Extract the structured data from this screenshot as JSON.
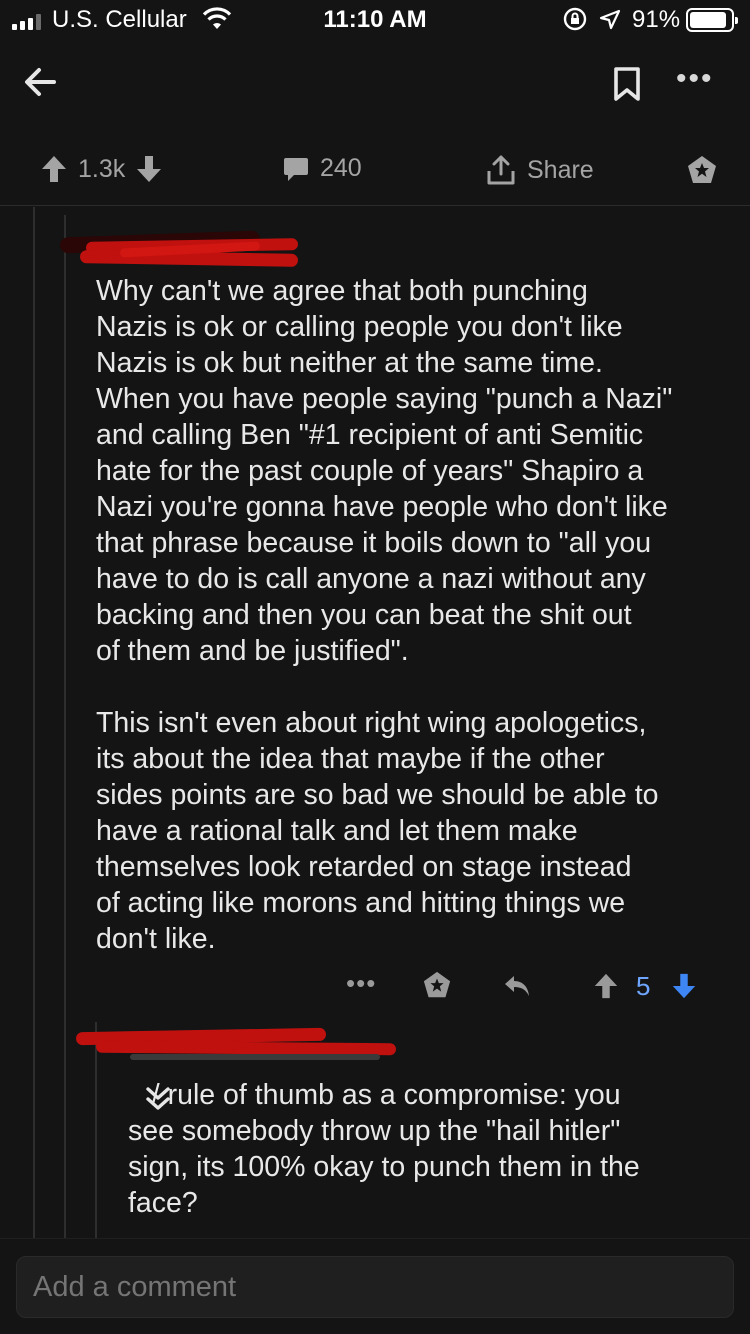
{
  "status_bar": {
    "carrier": "U.S. Cellular",
    "time": "11:10 AM",
    "battery": "91%"
  },
  "post_actions": {
    "upvotes": "1.3k",
    "comments": "240",
    "share_label": "Share"
  },
  "comment": {
    "body": "Why can't we agree that both punching\nNazis is ok or calling people you don't like\nNazis is ok but neither at the same time.\nWhen you have people saying \"punch a Nazi\"\nand calling Ben \"#1 recipient of anti Semitic\nhate for the past couple of years\" Shapiro a\nNazi you're gonna have people who don't like\nthat phrase because it boils down to \"all you\nhave to do is call anyone a nazi without any\nbacking and then you can beat the shit out\nof them and be justified\".\n\nThis isn't even about right wing apologetics,\nits about the idea that maybe if the other\nsides points are so bad we should be able to\nhave a rational talk and let them make\nthemselves look retarded on stage instead\nof acting like morons and hitting things we\ndon't like.",
    "score": "5",
    "more_label": "•••"
  },
  "reply": {
    "body": "   / rule of thumb as a compromise: you\nsee somebody throw up the \"hail hitler\"\nsign, its 100% okay to punch them in the\nface?"
  },
  "composer": {
    "placeholder": "Add a comment"
  },
  "colors": {
    "background": "#141414",
    "text": "#e8e8e8",
    "muted": "#a4a4a4",
    "score_blue": "#6ea6ff",
    "downvote_blue": "#3f86f5",
    "redaction": "#c0110f"
  }
}
